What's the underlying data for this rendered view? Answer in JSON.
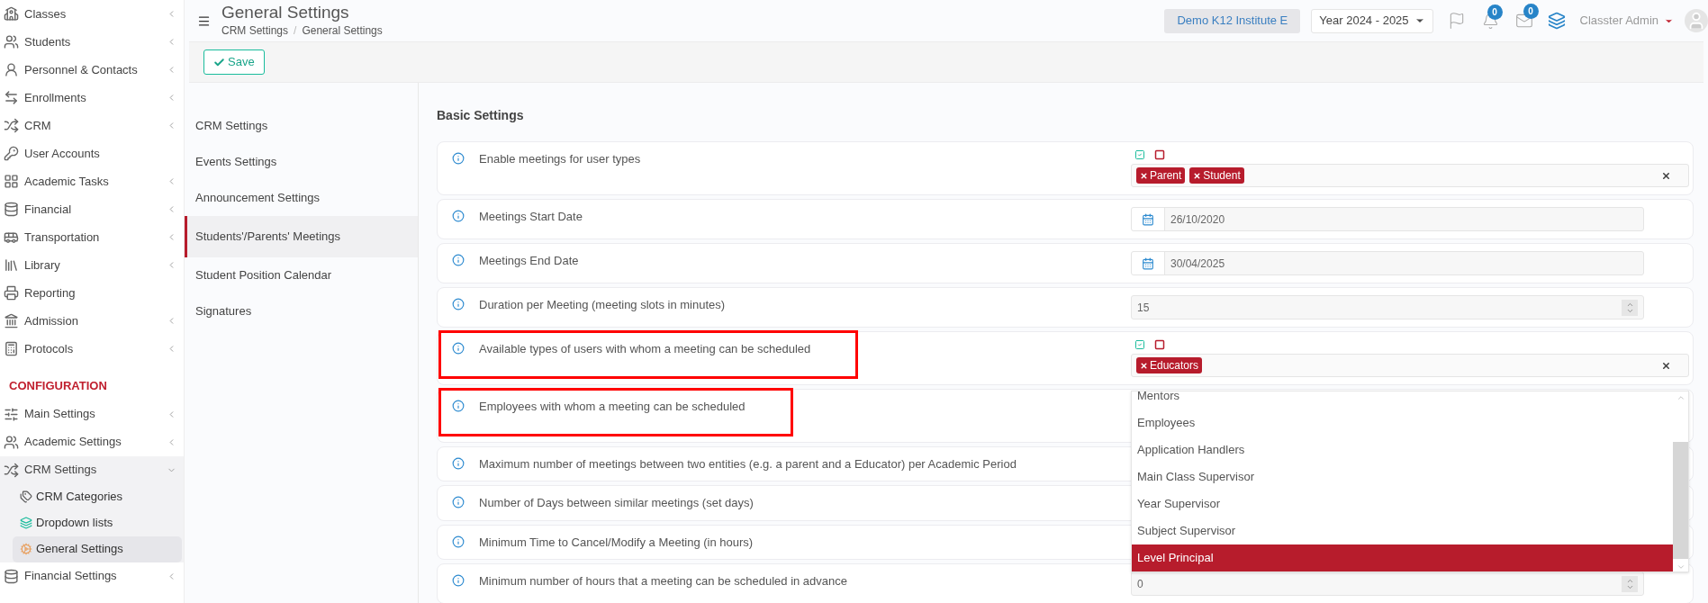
{
  "sidebar": {
    "items": [
      {
        "label": "Classes",
        "has_submenu": true,
        "selected": false
      },
      {
        "label": "Students",
        "has_submenu": true,
        "selected": false
      },
      {
        "label": "Personnel & Contacts",
        "has_submenu": true,
        "selected": false
      },
      {
        "label": "Enrollments",
        "has_submenu": true,
        "selected": false
      },
      {
        "label": "CRM",
        "has_submenu": true,
        "selected": false
      },
      {
        "label": "User Accounts",
        "has_submenu": false,
        "selected": false
      },
      {
        "label": "Academic Tasks",
        "has_submenu": true,
        "selected": false
      },
      {
        "label": "Financial",
        "has_submenu": true,
        "selected": false
      },
      {
        "label": "Transportation",
        "has_submenu": true,
        "selected": false
      },
      {
        "label": "Library",
        "has_submenu": true,
        "selected": false
      },
      {
        "label": "Reporting",
        "has_submenu": false,
        "selected": false
      },
      {
        "label": "Admission",
        "has_submenu": true,
        "selected": false
      },
      {
        "label": "Protocols",
        "has_submenu": true,
        "selected": false
      }
    ],
    "section_title": "CONFIGURATION",
    "config_items": [
      {
        "label": "Main Settings",
        "has_submenu": true,
        "expanded": false,
        "selected": false
      },
      {
        "label": "Academic Settings",
        "has_submenu": true,
        "expanded": false,
        "selected": false
      },
      {
        "label": "CRM Settings",
        "has_submenu": true,
        "expanded": true,
        "selected": false,
        "children": [
          {
            "label": "CRM Categories",
            "selected": false
          },
          {
            "label": "Dropdown lists",
            "selected": false
          },
          {
            "label": "General Settings",
            "selected": true
          }
        ]
      },
      {
        "label": "Financial Settings",
        "has_submenu": true,
        "expanded": false,
        "selected": false
      }
    ]
  },
  "header": {
    "title": "General Settings",
    "breadcrumb": [
      "CRM Settings",
      "General Settings"
    ],
    "breadcrumb_separator": "/",
    "institute": "Demo K12 Institute E",
    "year": "Year 2024 - 2025",
    "notifications_count": "0",
    "messages_count": "0",
    "user": "Classter Admin"
  },
  "toolbar": {
    "save": "Save"
  },
  "settings_nav": [
    {
      "label": "CRM Settings",
      "selected": false
    },
    {
      "label": "Events Settings",
      "selected": false
    },
    {
      "label": "Announcement Settings",
      "selected": false
    },
    {
      "label": "Students'/Parents' Meetings",
      "selected": true
    },
    {
      "label": "Student Position Calendar",
      "selected": false
    },
    {
      "label": "Signatures",
      "selected": false
    }
  ],
  "section_title": "Basic Settings",
  "rows": [
    {
      "label": "Enable meetings for user types",
      "kind": "multiselect",
      "highlighted": false,
      "tags": [
        "Parent",
        "Student"
      ]
    },
    {
      "label": "Meetings Start Date",
      "kind": "date",
      "highlighted": false,
      "value": "26/10/2020"
    },
    {
      "label": "Meetings End Date",
      "kind": "date",
      "highlighted": false,
      "value": "30/04/2025"
    },
    {
      "label": "Duration per Meeting (meeting slots in minutes)",
      "kind": "number",
      "highlighted": false,
      "value": "15"
    },
    {
      "label": "Available types of users with whom a meeting can be scheduled",
      "kind": "multiselect",
      "highlighted": true,
      "tags": [
        "Educators"
      ],
      "dropdown": [
        {
          "label": "Mentors",
          "selected": false
        },
        {
          "label": "Employees",
          "selected": false
        },
        {
          "label": "Application Handlers",
          "selected": false
        },
        {
          "label": "Main Class Supervisor",
          "selected": false
        },
        {
          "label": "Year Supervisor",
          "selected": false
        },
        {
          "label": "Subject Supervisor",
          "selected": false
        },
        {
          "label": "Level Principal",
          "selected": true
        }
      ]
    },
    {
      "label": "Employees with whom a meeting can be scheduled",
      "kind": "covered",
      "highlighted": true
    },
    {
      "label": "Maximum number of meetings between two entities (e.g. a parent and a Educator) per Academic Period",
      "kind": "covered",
      "highlighted": false
    },
    {
      "label": "Number of Days between similar meetings (set days)",
      "kind": "covered",
      "highlighted": false
    },
    {
      "label": "Minimum Time to Cancel/Modify a Meeting (in hours)",
      "kind": "covered",
      "highlighted": false
    },
    {
      "label": "Minimum number of hours that a meeting can be scheduled in advance",
      "kind": "number",
      "highlighted": false,
      "value": "0"
    }
  ]
}
